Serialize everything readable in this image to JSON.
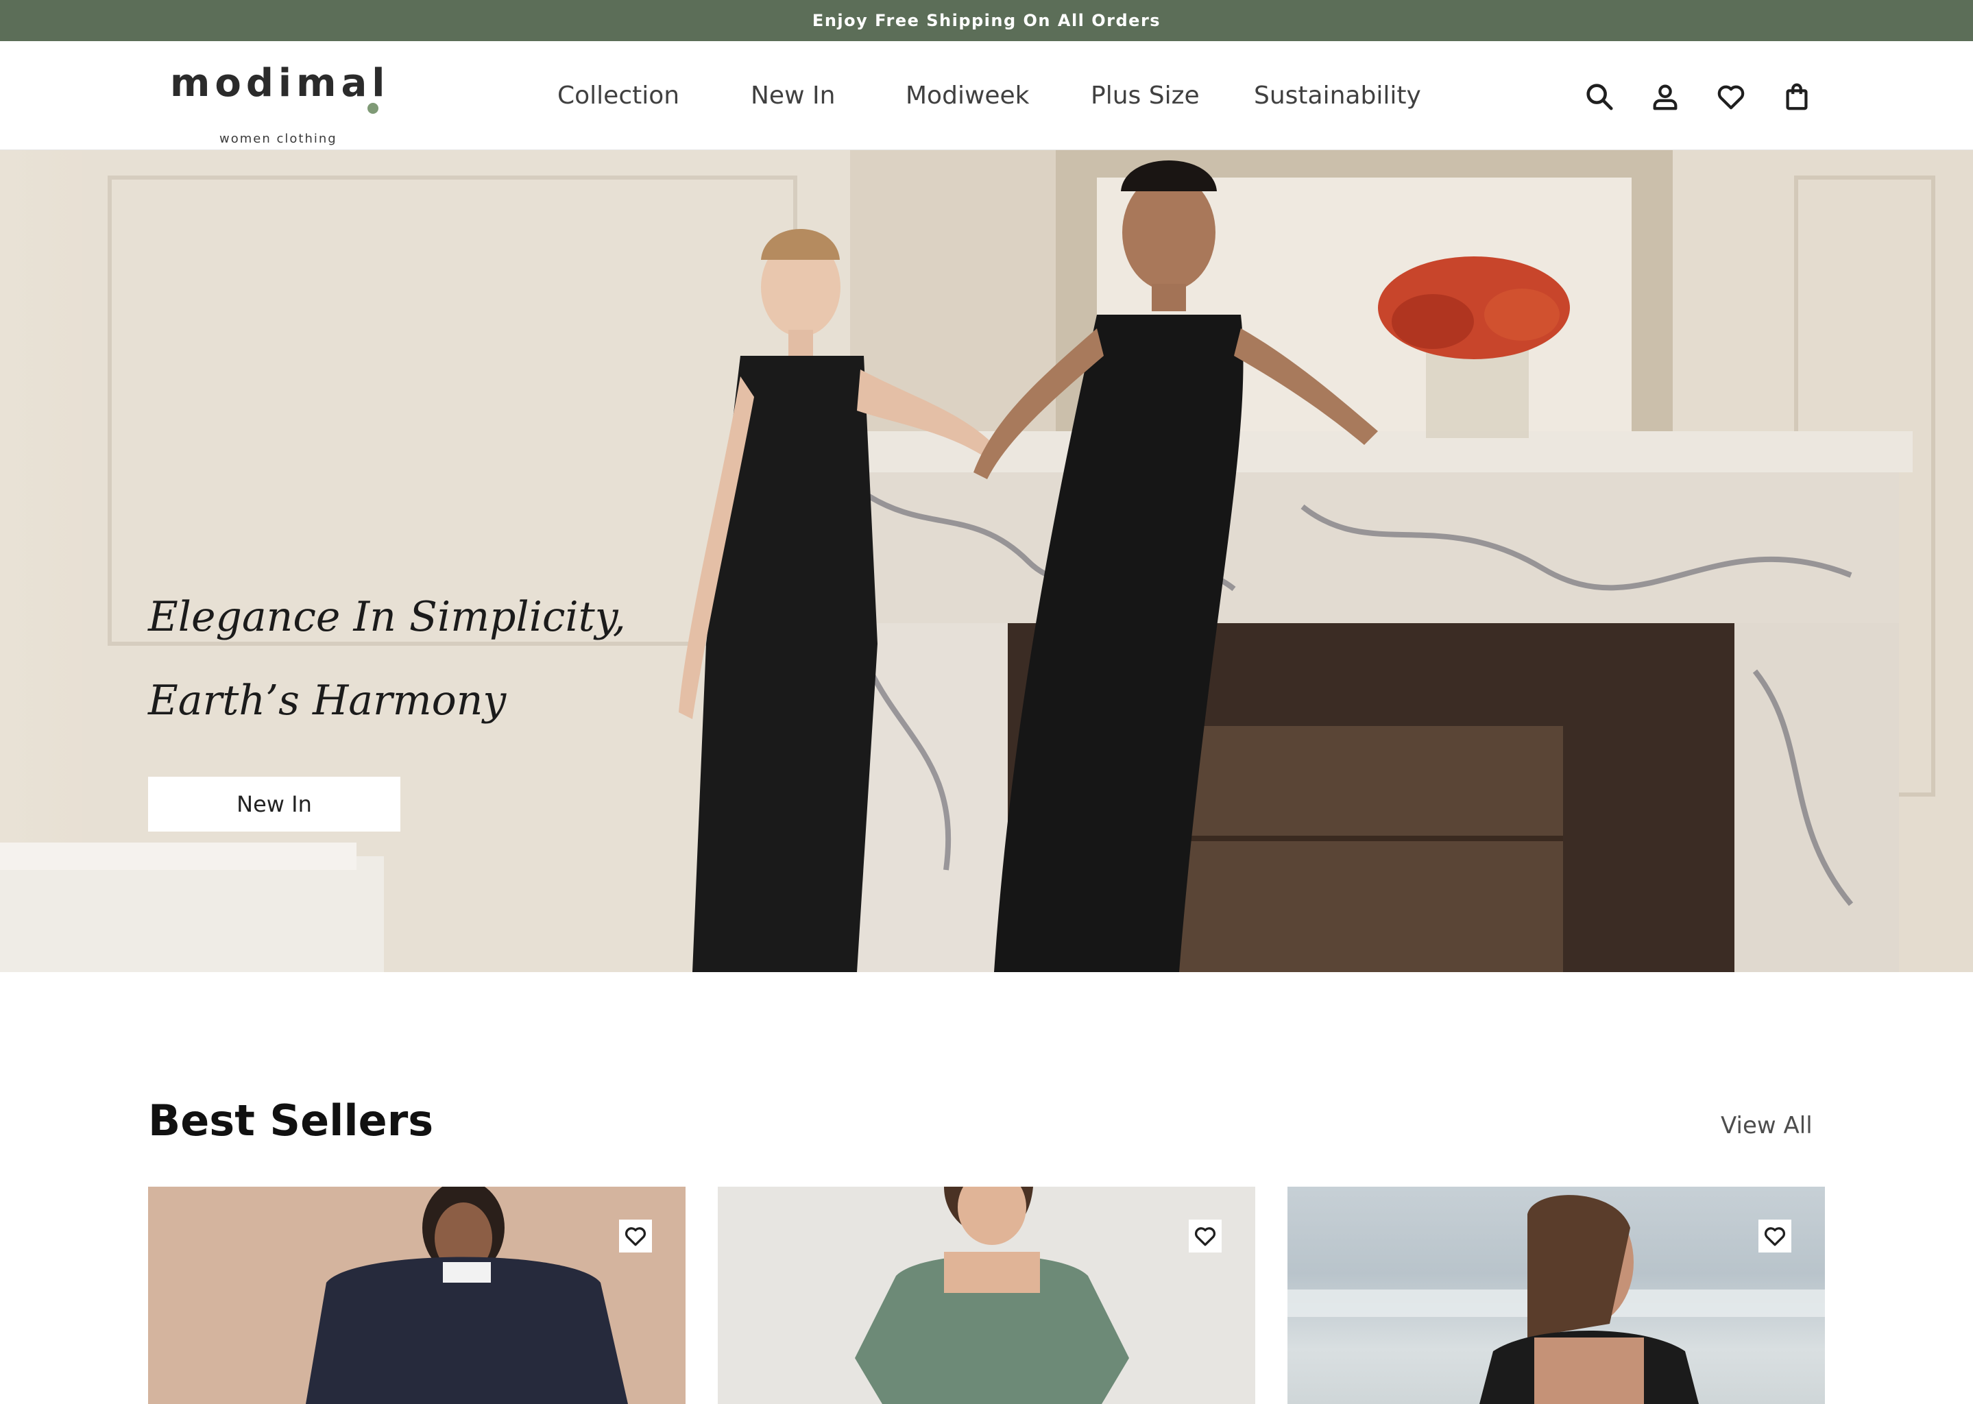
{
  "announcement": {
    "text": "Enjoy Free Shipping On All Orders"
  },
  "brand": {
    "name": "modimal",
    "tagline": "women clothing",
    "accent": "#7f9a76"
  },
  "nav": {
    "items": [
      {
        "label": "Collection"
      },
      {
        "label": "New In"
      },
      {
        "label": "Modiweek"
      },
      {
        "label": "Plus Size"
      },
      {
        "label": "Sustainability"
      }
    ]
  },
  "header_icons": [
    "search-icon",
    "account-icon",
    "wishlist-heart-icon",
    "shopping-bag-icon"
  ],
  "hero": {
    "headline_line1": "Elegance In Simplicity,",
    "headline_line2": "Earth’s Harmony",
    "cta_label": "New In"
  },
  "best_sellers": {
    "title": "Best Sellers",
    "view_all_label": "View All",
    "products": [
      {
        "image": "woman in navy sweatshirt",
        "wishlist_icon": "heart-icon"
      },
      {
        "image": "woman in sage green dress",
        "wishlist_icon": "heart-icon"
      },
      {
        "image": "woman on beach in black top",
        "wishlist_icon": "heart-icon"
      }
    ]
  },
  "colors": {
    "announcement_bg": "#5c6e58",
    "text_dark": "#1b1b1b",
    "nav_text": "#404040"
  }
}
